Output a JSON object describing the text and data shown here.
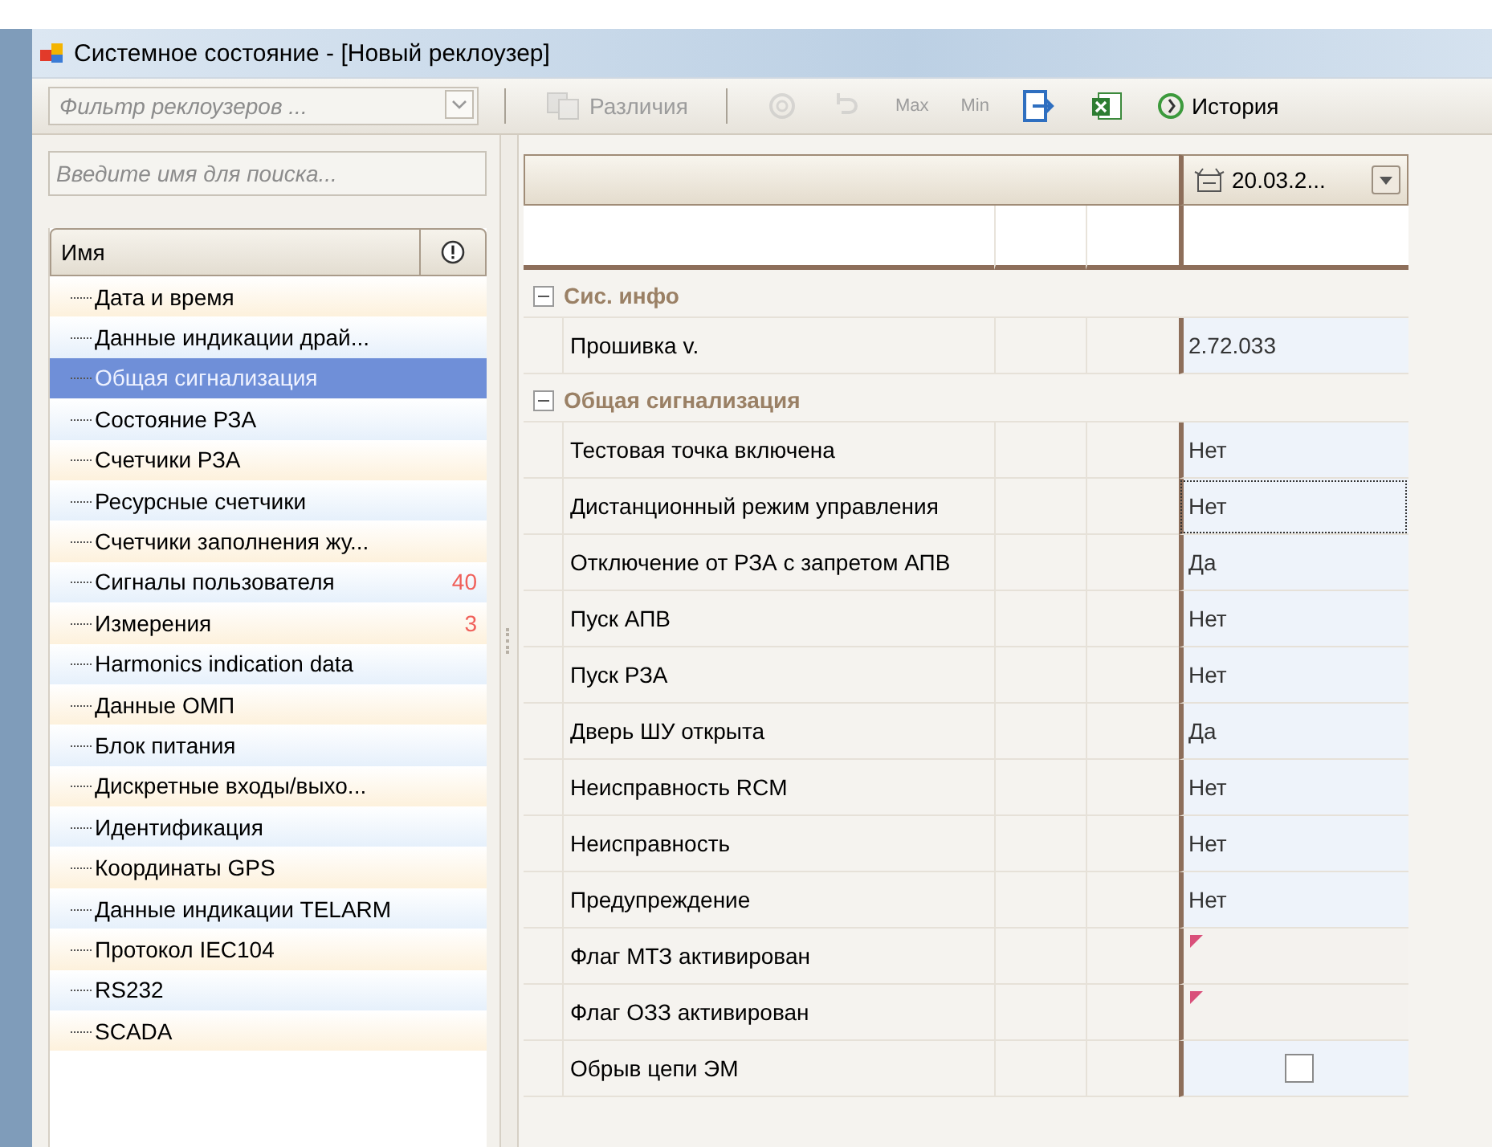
{
  "window": {
    "title": "Системное состояние - [Новый реклоузер]"
  },
  "toolbar": {
    "filter": {
      "placeholder": "Фильтр реклоузеров ..."
    },
    "items": [
      {
        "kind": "diff",
        "label": "Различия",
        "disabled": true
      },
      {
        "kind": "refresh",
        "disabled": true
      },
      {
        "kind": "undo",
        "disabled": true
      },
      {
        "kind": "max",
        "label": "Max",
        "disabled": true
      },
      {
        "kind": "min",
        "label": "Min",
        "disabled": true
      },
      {
        "kind": "export",
        "disabled": false
      },
      {
        "kind": "excel",
        "disabled": false
      },
      {
        "kind": "history",
        "label": "История",
        "disabled": false
      }
    ]
  },
  "tree": {
    "search": {
      "placeholder": "Введите имя для поиска..."
    },
    "column": "Имя",
    "items": [
      {
        "label": "Дата и время",
        "selected": false
      },
      {
        "label": "Данные индикации драй...",
        "selected": false
      },
      {
        "label": "Общая сигнализация",
        "selected": true
      },
      {
        "label": "Состояние РЗА",
        "selected": false
      },
      {
        "label": "Счетчики РЗА",
        "selected": false
      },
      {
        "label": "Ресурсные счетчики",
        "selected": false
      },
      {
        "label": "Счетчики заполнения жу...",
        "selected": false
      },
      {
        "label": "Сигналы пользователя",
        "count": "40",
        "selected": false
      },
      {
        "label": "Измерения",
        "count": "3",
        "selected": false
      },
      {
        "label": "Harmonics indication data",
        "selected": false
      },
      {
        "label": "Данные ОМП",
        "selected": false
      },
      {
        "label": "Блок питания",
        "selected": false
      },
      {
        "label": "Дискретные входы/выхо...",
        "selected": false
      },
      {
        "label": "Идентификация",
        "selected": false
      },
      {
        "label": "Координаты GPS",
        "selected": false
      },
      {
        "label": "Данные индикации TELARM",
        "selected": false
      },
      {
        "label": "Протокол IEC104",
        "selected": false
      },
      {
        "label": "RS232",
        "selected": false
      },
      {
        "label": "SCADA",
        "selected": false
      }
    ]
  },
  "grid": {
    "date": "20.03.2...",
    "groups": [
      {
        "title": "Сис. инфо",
        "expanded": true,
        "rows": [
          {
            "label": "Прошивка v.",
            "kind": "text",
            "value": "2.72.033",
            "focused": false
          }
        ]
      },
      {
        "title": "Общая сигнализация",
        "expanded": true,
        "rows": [
          {
            "label": "Тестовая точка включена",
            "kind": "text",
            "value": "Нет",
            "focused": false
          },
          {
            "label": "Дистанционный режим управления",
            "kind": "text",
            "value": "Нет",
            "focused": true
          },
          {
            "label": "Отключение от РЗА с запретом АПВ",
            "kind": "text",
            "value": "Да",
            "focused": false
          },
          {
            "label": "Пуск АПВ",
            "kind": "text",
            "value": "Нет",
            "focused": false
          },
          {
            "label": "Пуск РЗА",
            "kind": "text",
            "value": "Нет",
            "focused": false
          },
          {
            "label": "Дверь ШУ открыта",
            "kind": "text",
            "value": "Да",
            "focused": false
          },
          {
            "label": "Неисправность RCM",
            "kind": "text",
            "value": "Нет",
            "focused": false
          },
          {
            "label": "Неисправность",
            "kind": "text",
            "value": "Нет",
            "focused": false
          },
          {
            "label": "Предупреждение",
            "kind": "text",
            "value": "Нет",
            "focused": false
          },
          {
            "label": "Флаг МТЗ активирован",
            "kind": "flag",
            "focused": false
          },
          {
            "label": "Флаг ОЗЗ активирован",
            "kind": "flag",
            "focused": false
          },
          {
            "label": "Обрыв цепи ЭМ",
            "kind": "checkbox",
            "checked": false,
            "focused": false
          }
        ]
      }
    ]
  }
}
